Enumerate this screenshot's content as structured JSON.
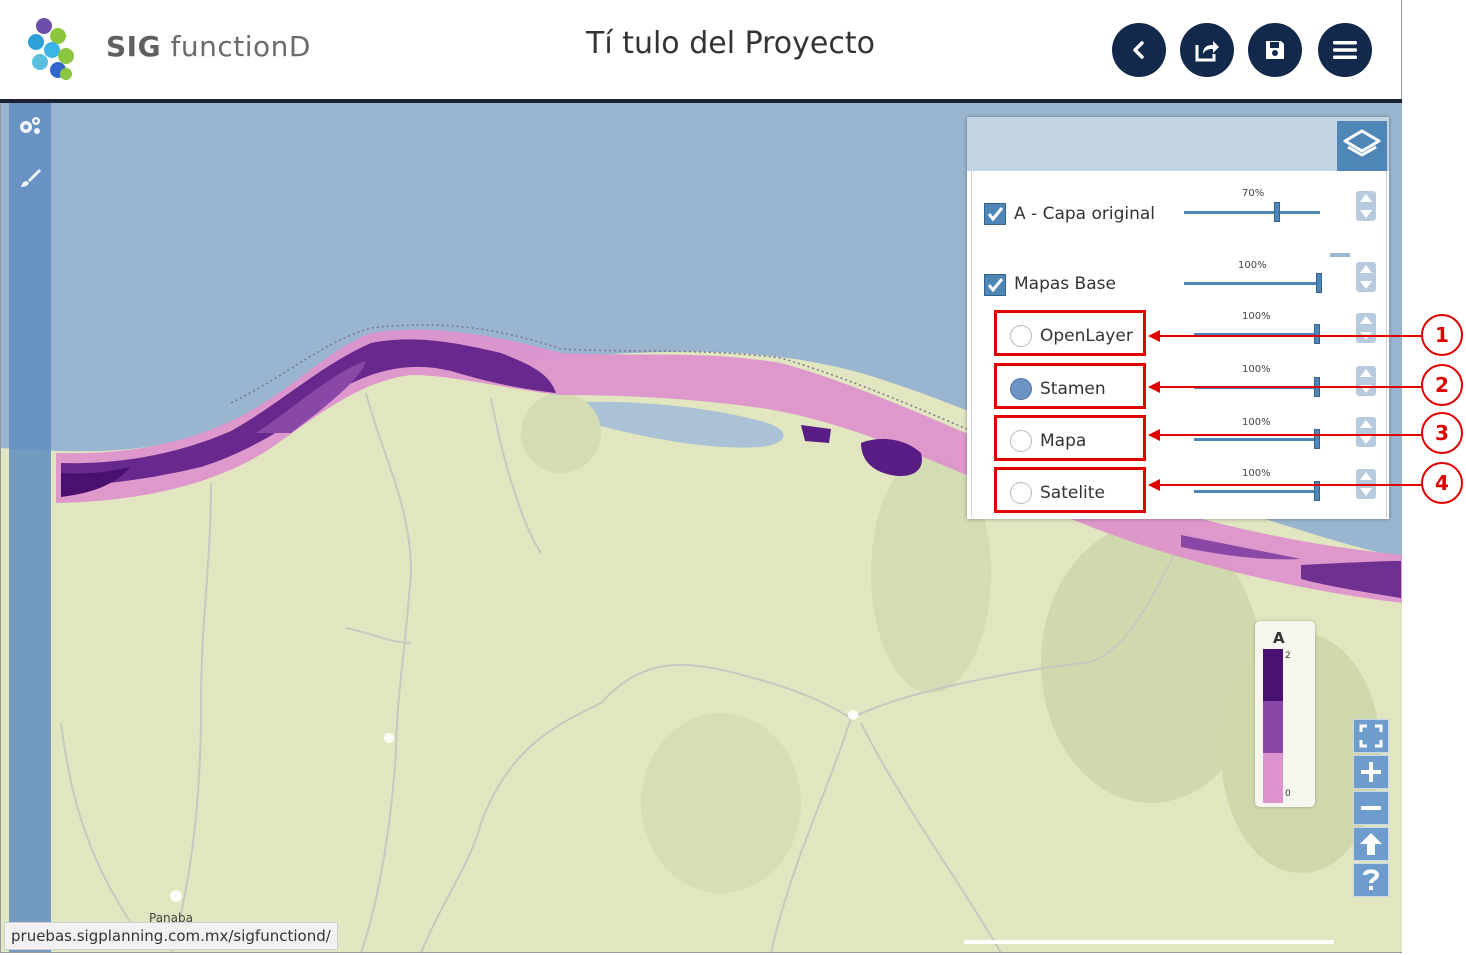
{
  "header": {
    "brand_bold": "SIG",
    "brand_rest": "functionD",
    "project_title": "Tí tulo del Proyecto",
    "buttons": [
      "back-icon",
      "share-icon",
      "save-icon",
      "menu-icon"
    ]
  },
  "toolbar": {
    "tools": [
      "gears-icon",
      "brush-icon"
    ]
  },
  "layers": {
    "toggle_icon": "layers-icon",
    "overlay": {
      "label": "A - Capa original",
      "opacity_label": "70%",
      "opacity": 0.7,
      "checked": true
    },
    "base_group": {
      "label": "Mapas Base",
      "opacity_label": "100%",
      "opacity": 1.0,
      "checked": true
    },
    "base_options": [
      {
        "label": "OpenLayer",
        "opacity_label": "100%",
        "selected": false
      },
      {
        "label": "Stamen",
        "opacity_label": "100%",
        "selected": true
      },
      {
        "label": "Mapa",
        "opacity_label": "100%",
        "selected": false
      },
      {
        "label": "Satelite",
        "opacity_label": "100%",
        "selected": false
      }
    ]
  },
  "annotations": [
    "1",
    "2",
    "3",
    "4"
  ],
  "legend": {
    "title": "A",
    "max": "2",
    "min": "0",
    "colors": [
      "#4a1070",
      "#8a48a6",
      "#dd93cc"
    ]
  },
  "zoom": [
    "fullscreen-icon",
    "zoom-in-icon",
    "zoom-out-icon",
    "north-arrow-icon",
    "help-icon"
  ],
  "map": {
    "town": "Panaba",
    "status_url": "pruebas.sigplanning.com.mx/sigfunctiond/"
  },
  "colors": {
    "header_button": "#13294b",
    "accent": "#4e86b8",
    "annotation": "#e00000",
    "sea": "#9ab5cf",
    "land": "#e2e6c0"
  }
}
